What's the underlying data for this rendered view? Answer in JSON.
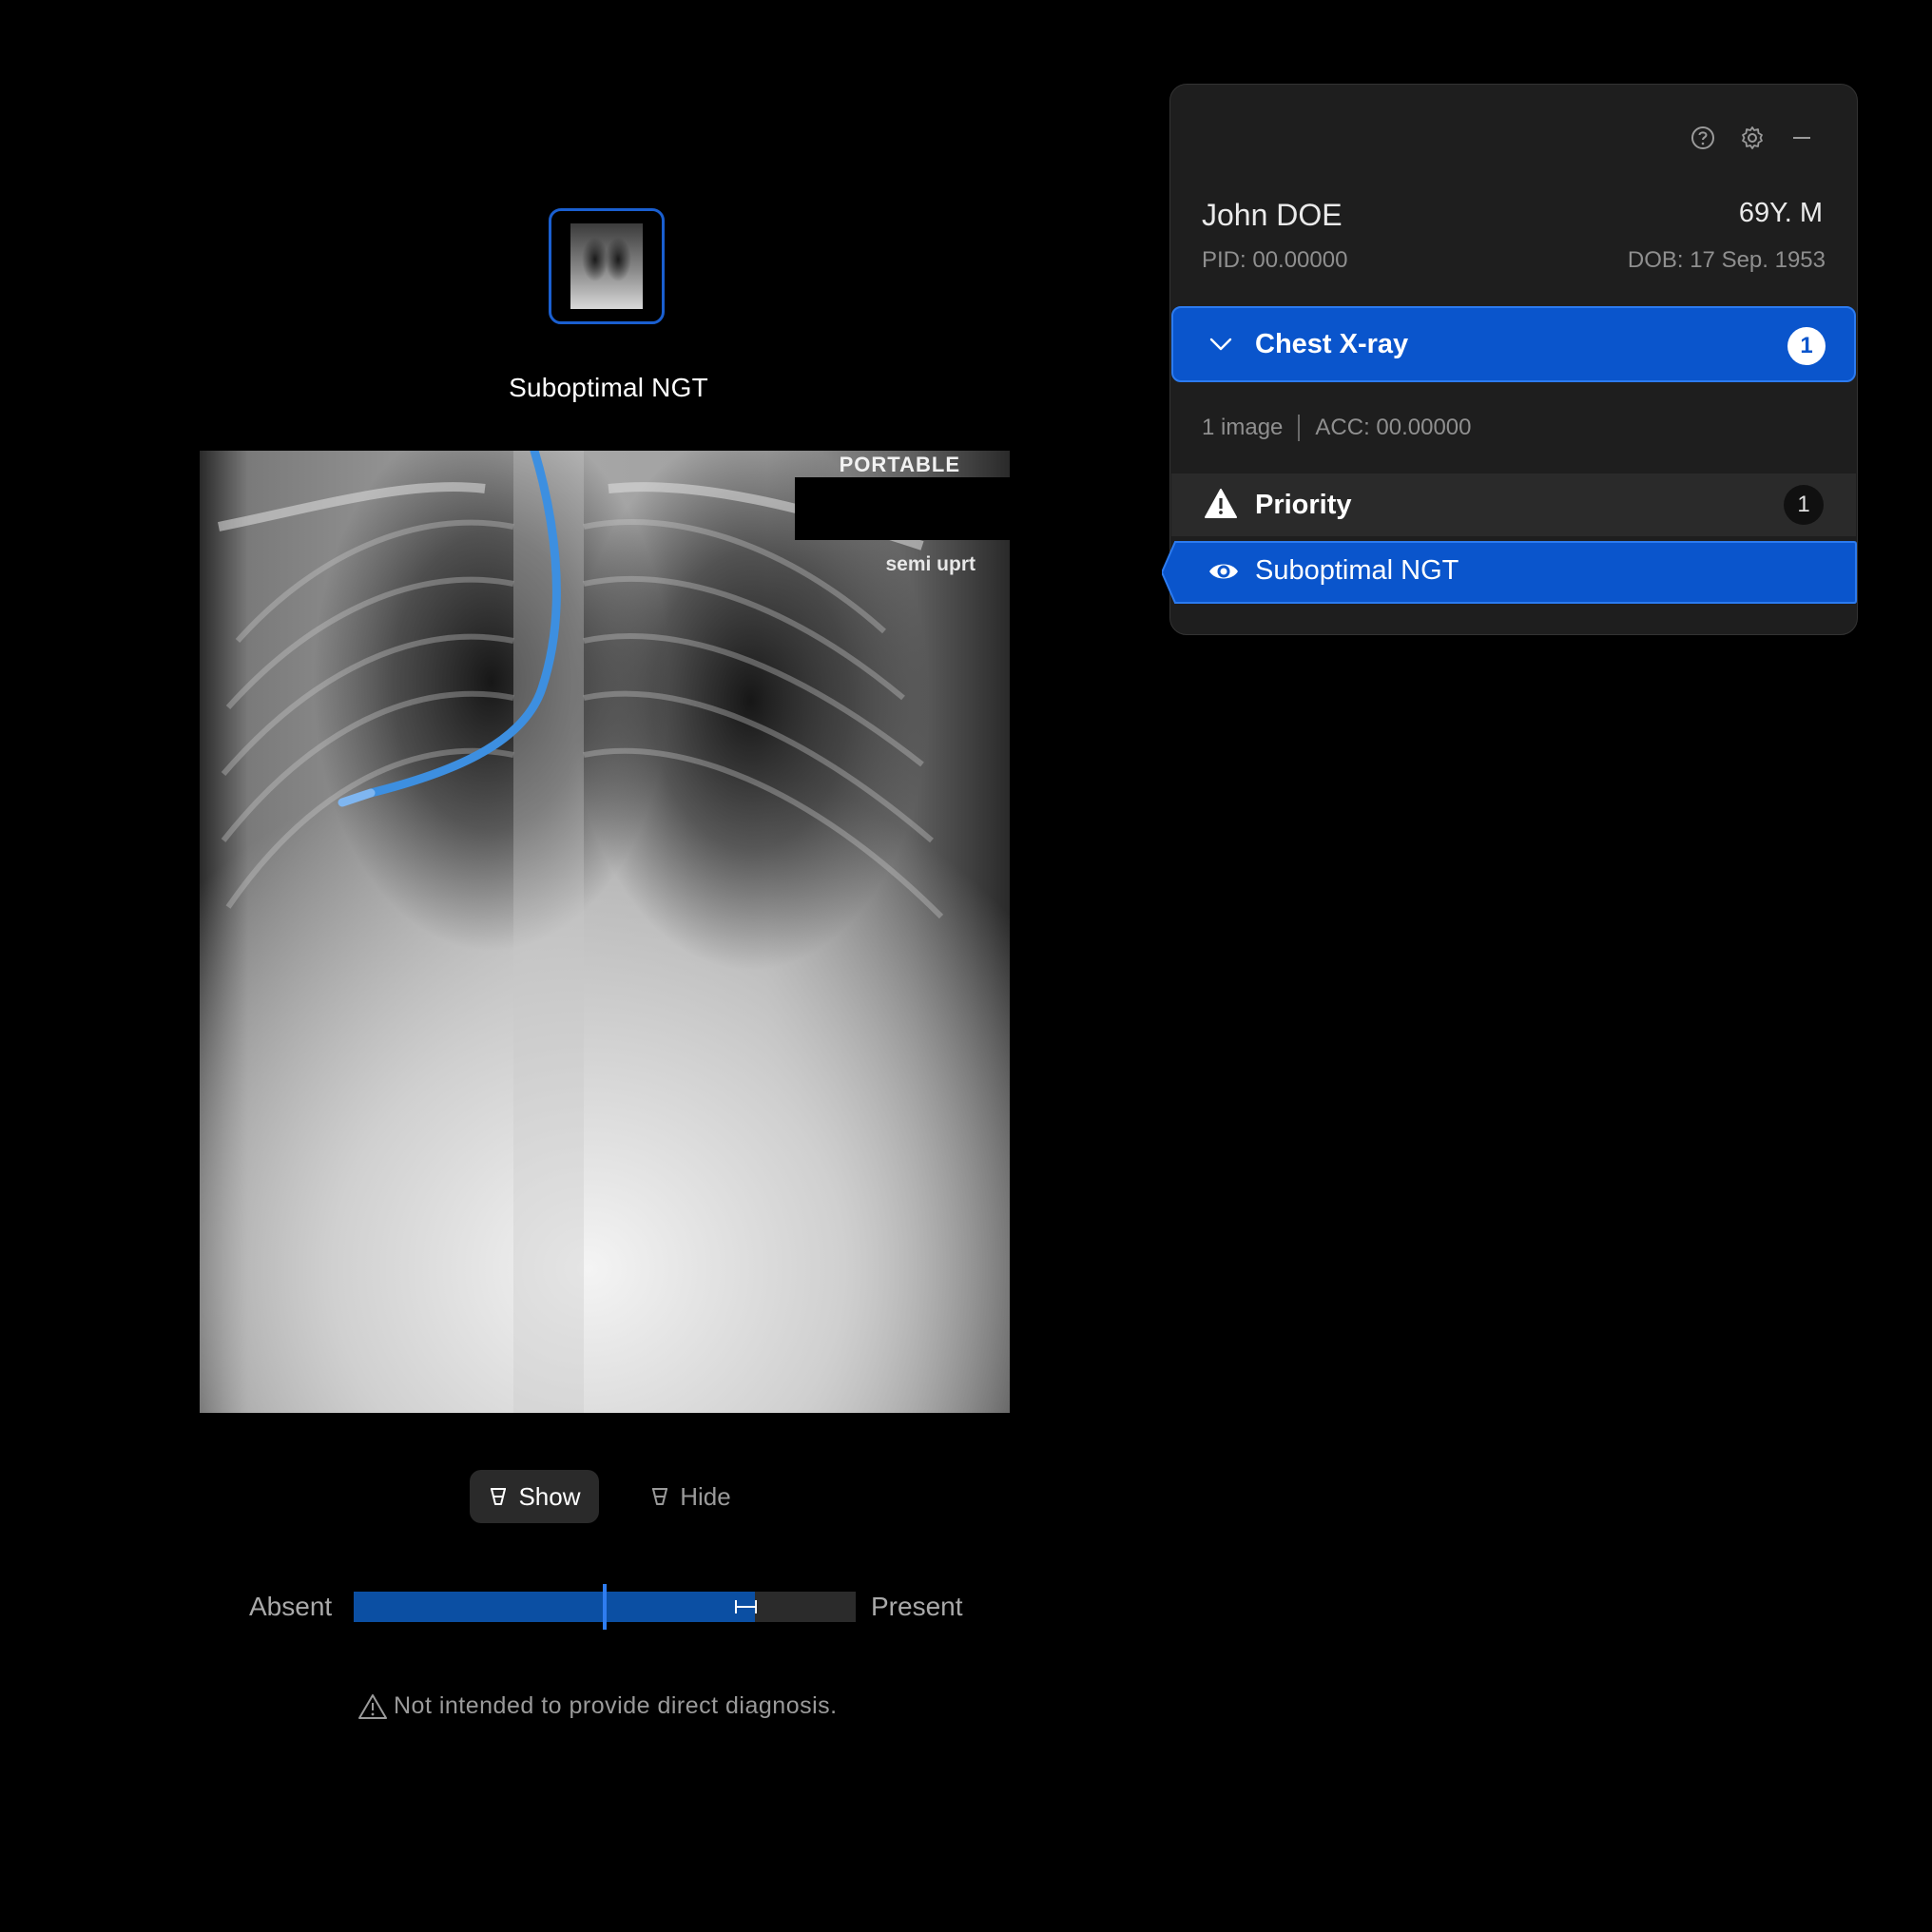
{
  "viewer": {
    "finding_title": "Suboptimal NGT",
    "image_annotations": {
      "portable": "PORTABLE",
      "position": "semi uprt"
    },
    "toggle": {
      "show_label": "Show",
      "hide_label": "Hide",
      "selected": "Show"
    },
    "scale": {
      "left_label": "Absent",
      "right_label": "Present",
      "score_fraction": 0.5,
      "range_fraction": [
        0.76,
        0.8
      ]
    },
    "disclaimer": "Not intended to provide direct diagnosis."
  },
  "panel": {
    "header_icons": [
      "help-icon",
      "settings-icon",
      "minimize-icon"
    ],
    "patient": {
      "name": "John DOE",
      "age_sex": "69Y. M",
      "pid": "PID: 00.00000",
      "dob": "DOB: 17 Sep. 1953"
    },
    "study": {
      "label": "Chest X-ray",
      "count": "1",
      "images": "1 image",
      "accession": "ACC: 00.00000"
    },
    "priority": {
      "label": "Priority",
      "count": "1"
    },
    "finding": {
      "label": "Suboptimal NGT",
      "selected": true
    }
  },
  "colors": {
    "accent": "#0a55cc",
    "accent_bright": "#2f7df0",
    "tube_overlay": "#3d8fe0",
    "panel_bg": "#1e1e1e",
    "background": "#000000"
  }
}
